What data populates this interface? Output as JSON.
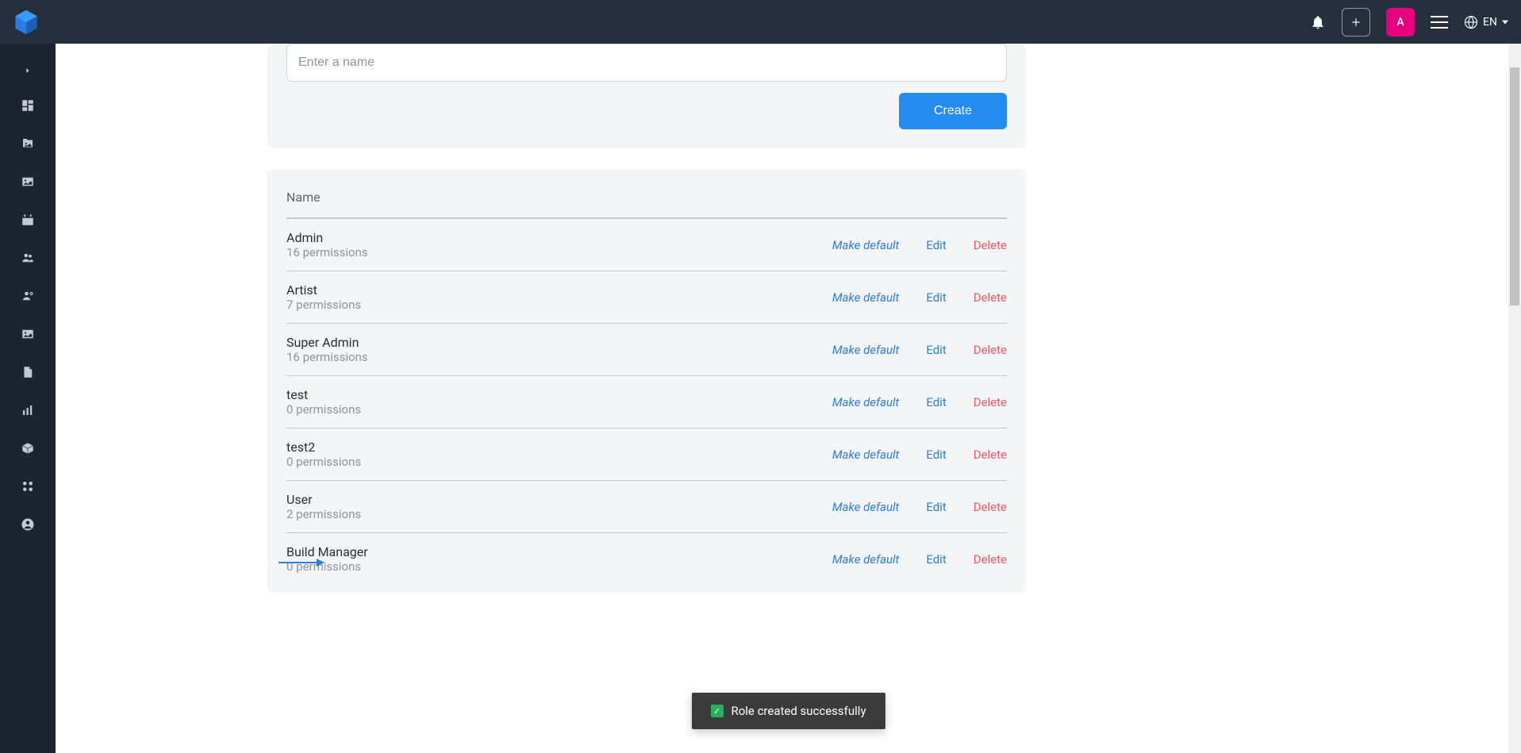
{
  "topbar": {
    "language": "EN",
    "avatar_letter": "A"
  },
  "create": {
    "placeholder": "Enter a name",
    "button": "Create"
  },
  "list": {
    "header": "Name",
    "actions": {
      "make_default": "Make default",
      "edit": "Edit",
      "delete": "Delete"
    },
    "rows": [
      {
        "name": "Admin",
        "permissions": "16 permissions"
      },
      {
        "name": "Artist",
        "permissions": "7 permissions"
      },
      {
        "name": "Super Admin",
        "permissions": "16 permissions"
      },
      {
        "name": "test",
        "permissions": "0 permissions"
      },
      {
        "name": "test2",
        "permissions": "0 permissions"
      },
      {
        "name": "User",
        "permissions": "2 permissions"
      },
      {
        "name": "Build Manager",
        "permissions": "0 permissions"
      }
    ]
  },
  "toast": {
    "message": "Role created successfully"
  }
}
